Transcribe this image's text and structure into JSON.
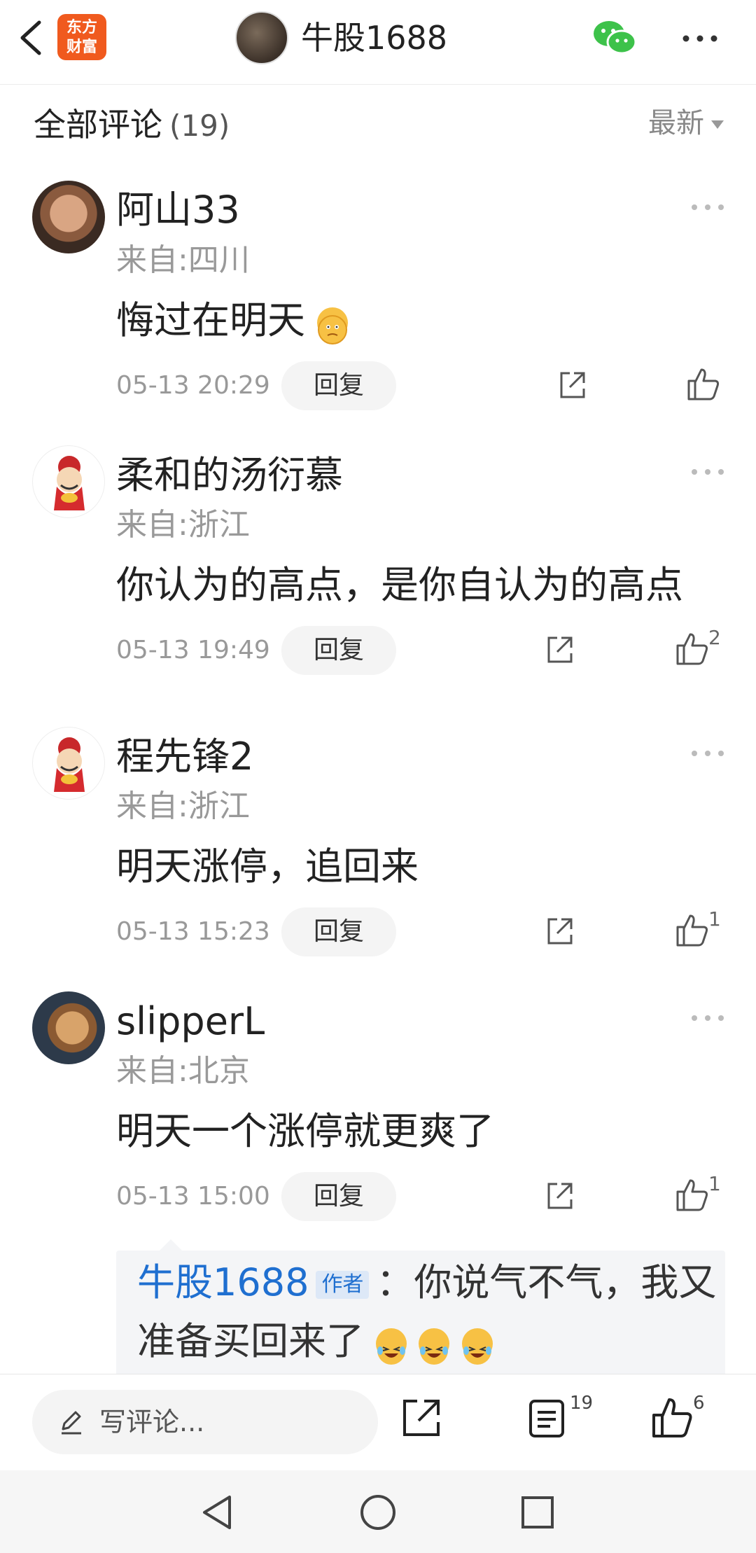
{
  "header": {
    "logo_line1": "东方",
    "logo_line2": "财富",
    "title": "牛股1688"
  },
  "section": {
    "title": "全部评论",
    "count": "(19)",
    "sort": "最新"
  },
  "comments": [
    {
      "user": "阿山33",
      "location": "来自:四川",
      "text": "悔过在明天",
      "time": "05-13 20:29",
      "reply": "回复",
      "likes": ""
    },
    {
      "user": "柔和的汤衍慕",
      "location": "来自:浙江",
      "text": "你认为的高点，是你自认为的高点",
      "time": "05-13 19:49",
      "reply": "回复",
      "likes": "2"
    },
    {
      "user": "程先锋2",
      "location": "来自:浙江",
      "text": "明天涨停，追回来",
      "time": "05-13 15:23",
      "reply": "回复",
      "likes": "1"
    },
    {
      "user": "slipperL",
      "location": "来自:北京",
      "text": "明天一个涨停就更爽了",
      "time": "05-13 15:00",
      "reply": "回复",
      "likes": "1"
    }
  ],
  "author_reply": {
    "author": "牛股1688",
    "tag": "作者",
    "line1": "：你说气不气，我又",
    "line2": "准备买回来了"
  },
  "bottom": {
    "placeholder": "写评论...",
    "comment_count": "19",
    "like_count": "6"
  },
  "colors": {
    "brand": "#f05a1e",
    "link": "#1f6fd0",
    "muted": "#999999"
  }
}
